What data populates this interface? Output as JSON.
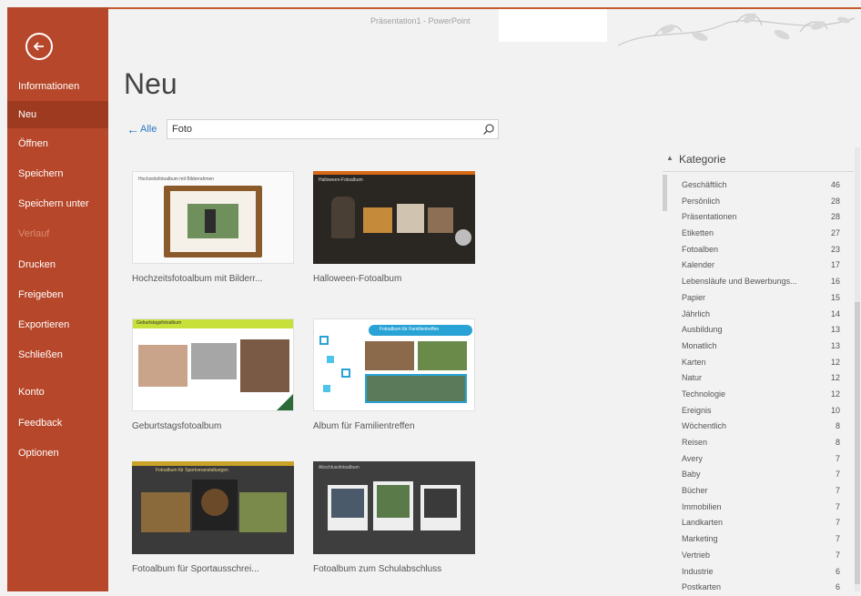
{
  "window": {
    "title": "Präsentation1 - PowerPoint"
  },
  "sidebar": {
    "items": [
      {
        "label": "Informationen"
      },
      {
        "label": "Neu"
      },
      {
        "label": "Öffnen"
      },
      {
        "label": "Speichern"
      },
      {
        "label": "Speichern unter"
      },
      {
        "label": "Verlauf"
      },
      {
        "label": "Drucken"
      },
      {
        "label": "Freigeben"
      },
      {
        "label": "Exportieren"
      },
      {
        "label": "Schließen"
      },
      {
        "label": "Konto"
      },
      {
        "label": "Feedback"
      },
      {
        "label": "Optionen"
      }
    ],
    "active_index": 1
  },
  "main": {
    "title": "Neu",
    "search": {
      "back_label": "Alle",
      "value": "Foto"
    }
  },
  "templates": [
    {
      "label": "Hochzeitsfotoalbum mit Bilderr...",
      "thumb_title": "Hochzeitsfotoalbum mit Bilderrahmen"
    },
    {
      "label": "Halloween-Fotoalbum",
      "thumb_title": "Halloween-Fotoalbum"
    },
    {
      "label": "Geburtstagsfotoalbum",
      "thumb_title": "Geburtstagsfotoalbum"
    },
    {
      "label": "Album für Familientreffen",
      "thumb_title": "Fotoalbum für Familientreffen"
    },
    {
      "label": "Fotoalbum für Sportausschrei...",
      "thumb_title": "Fotoalbum für Sportveranstaltungen"
    },
    {
      "label": "Fotoalbum zum Schulabschluss",
      "thumb_title": "Abschlussfotoalbum"
    }
  ],
  "categories": {
    "header": "Kategorie",
    "items": [
      {
        "name": "Geschäftlich",
        "count": "46"
      },
      {
        "name": "Persönlich",
        "count": "28"
      },
      {
        "name": "Präsentationen",
        "count": "28"
      },
      {
        "name": "Etiketten",
        "count": "27"
      },
      {
        "name": "Fotoalben",
        "count": "23"
      },
      {
        "name": "Kalender",
        "count": "17"
      },
      {
        "name": "Lebensläufe und Bewerbungs...",
        "count": "16"
      },
      {
        "name": "Papier",
        "count": "15"
      },
      {
        "name": "Jährlich",
        "count": "14"
      },
      {
        "name": "Ausbildung",
        "count": "13"
      },
      {
        "name": "Monatlich",
        "count": "13"
      },
      {
        "name": "Karten",
        "count": "12"
      },
      {
        "name": "Natur",
        "count": "12"
      },
      {
        "name": "Technologie",
        "count": "12"
      },
      {
        "name": "Ereignis",
        "count": "10"
      },
      {
        "name": "Wöchentlich",
        "count": "8"
      },
      {
        "name": "Reisen",
        "count": "8"
      },
      {
        "name": "Avery",
        "count": "7"
      },
      {
        "name": "Baby",
        "count": "7"
      },
      {
        "name": "Bücher",
        "count": "7"
      },
      {
        "name": "Immobilien",
        "count": "7"
      },
      {
        "name": "Landkarten",
        "count": "7"
      },
      {
        "name": "Marketing",
        "count": "7"
      },
      {
        "name": "Vertrieb",
        "count": "7"
      },
      {
        "name": "Industrie",
        "count": "6"
      },
      {
        "name": "Postkarten",
        "count": "6"
      }
    ]
  },
  "colors": {
    "accent": "#b7472a",
    "active_nav": "#9e3a1f",
    "link": "#2b78c5"
  }
}
